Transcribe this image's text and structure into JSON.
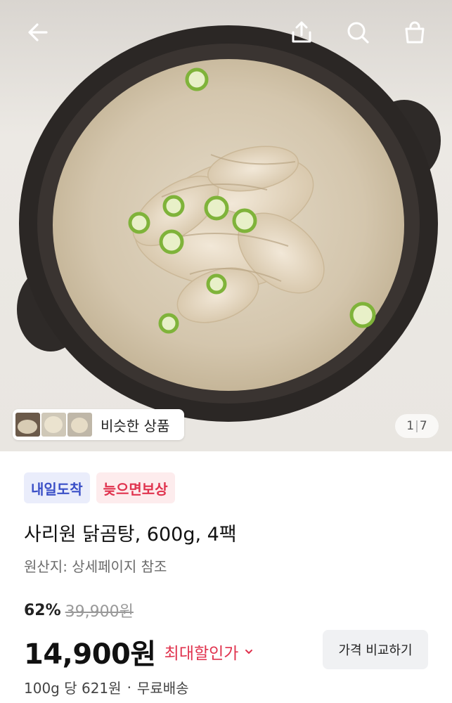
{
  "topbar": {
    "back_icon": "arrow-left-icon",
    "share_icon": "share-icon",
    "search_icon": "search-icon",
    "cart_icon": "shopping-bag-icon"
  },
  "gallery": {
    "similar_label": "비슷한 상품",
    "current": "1",
    "total": "7"
  },
  "badges": {
    "delivery": "내일도착",
    "late_compensation": "늦으면보상"
  },
  "product": {
    "title": "사리원 닭곰탕, 600g, 4팩",
    "origin": "원산지: 상세페이지 참조"
  },
  "pricing": {
    "discount": "62%",
    "original_price": "39,900원",
    "price": "14,900원",
    "max_discount_label": "최대할인가",
    "compare_label": "가격 비교하기",
    "unit_price": "100g 당 621원",
    "shipping": "무료배송"
  },
  "colors": {
    "accent_red": "#e0334e",
    "accent_blue": "#3a4fc7"
  }
}
